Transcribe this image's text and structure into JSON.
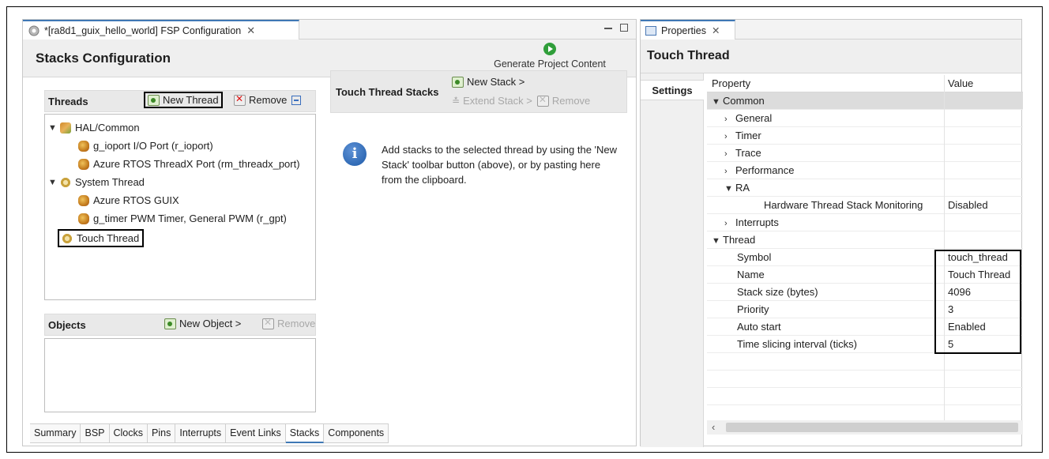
{
  "editor": {
    "tab_title": "*[ra8d1_guix_hello_world] FSP Configuration",
    "tab_close": "✕",
    "page_title": "Stacks Configuration",
    "generate_label": "Generate Project Content"
  },
  "threads": {
    "title": "Threads",
    "new_thread": "New Thread",
    "remove": "Remove",
    "tree": {
      "hal_common": "HAL/Common",
      "g_ioport": "g_ioport I/O Port (r_ioport)",
      "threadx_port": "Azure RTOS ThreadX Port (rm_threadx_port)",
      "system_thread": "System Thread",
      "guix": "Azure RTOS GUIX",
      "g_timer": "g_timer PWM Timer, General PWM (r_gpt)",
      "touch_thread": "Touch Thread"
    }
  },
  "stacks": {
    "title": "Touch Thread Stacks",
    "new_stack": "New Stack >",
    "extend_stack": "Extend Stack >",
    "remove": "Remove",
    "info": "Add stacks to the selected thread by using the 'New Stack' toolbar button (above), or by pasting here from the clipboard."
  },
  "objects": {
    "title": "Objects",
    "new_object": "New Object >",
    "remove": "Remove"
  },
  "bottom_tabs": [
    "Summary",
    "BSP",
    "Clocks",
    "Pins",
    "Interrupts",
    "Event Links",
    "Stacks",
    "Components"
  ],
  "properties": {
    "tab_title": "Properties",
    "tab_close": "✕",
    "title": "Touch Thread",
    "side_tab": "Settings",
    "col_property": "Property",
    "col_value": "Value",
    "rows": {
      "common": "Common",
      "general": "General",
      "timer": "Timer",
      "trace": "Trace",
      "performance": "Performance",
      "ra": "RA",
      "hw_stack_mon": "Hardware Thread Stack Monitoring",
      "hw_stack_mon_val": "Disabled",
      "interrupts": "Interrupts",
      "thread": "Thread",
      "symbol": "Symbol",
      "symbol_val": "touch_thread",
      "name": "Name",
      "name_val": "Touch Thread",
      "stack_size": "Stack size (bytes)",
      "stack_size_val": "4096",
      "priority": "Priority",
      "priority_val": "3",
      "auto_start": "Auto start",
      "auto_start_val": "Enabled",
      "slicing": "Time slicing interval (ticks)",
      "slicing_val": "5"
    }
  },
  "colors": {
    "accent": "#3f78b5",
    "generate_green": "#2f9e3a"
  }
}
